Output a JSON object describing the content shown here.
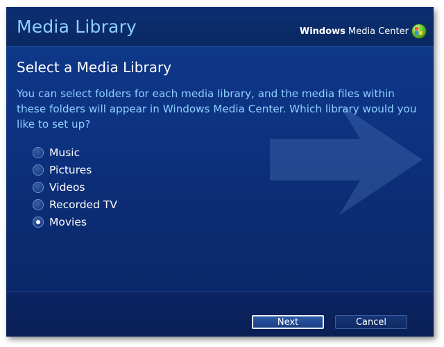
{
  "header": {
    "app_title": "Media Library",
    "brand_prefix": "Windows",
    "brand_suffix": " Media Center"
  },
  "page": {
    "title": "Select a Media Library",
    "description": "You can select folders for each media library, and the media files within these folders will appear in Windows Media Center.  Which library would you like to set up?"
  },
  "options": [
    {
      "label": "Music",
      "checked": false
    },
    {
      "label": "Pictures",
      "checked": false
    },
    {
      "label": "Videos",
      "checked": false
    },
    {
      "label": "Recorded TV",
      "checked": false
    },
    {
      "label": "Movies",
      "checked": true
    }
  ],
  "buttons": {
    "next": "Next",
    "cancel": "Cancel"
  },
  "colors": {
    "background": "#0d3382",
    "title_text": "#8ed0ff",
    "body_text": "#ffffff"
  }
}
